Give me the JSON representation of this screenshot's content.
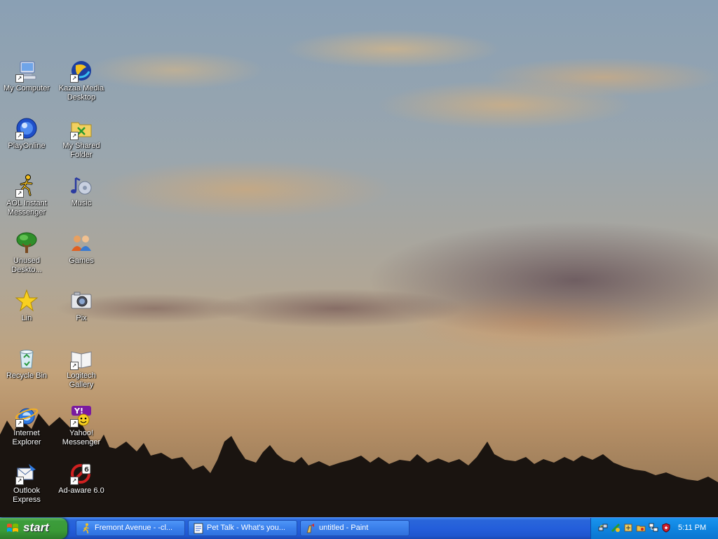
{
  "desktop": {
    "icons": [
      {
        "label": "My Computer",
        "icon": "my-computer-icon",
        "shortcut": true
      },
      {
        "label": "Kazaa Media Desktop",
        "icon": "kazaa-icon",
        "shortcut": true
      },
      {
        "label": "PlayOnline",
        "icon": "playonline-icon",
        "shortcut": true
      },
      {
        "label": "My Shared Folder",
        "icon": "shared-folder-icon",
        "shortcut": true
      },
      {
        "label": "AOL Instant Messenger",
        "icon": "aim-icon",
        "shortcut": true
      },
      {
        "label": "Music",
        "icon": "music-icon",
        "shortcut": false
      },
      {
        "label": "Unused Deskto...",
        "icon": "tree-icon",
        "shortcut": false
      },
      {
        "label": "Games",
        "icon": "games-icon",
        "shortcut": false
      },
      {
        "label": "Lin",
        "icon": "star-icon",
        "shortcut": false
      },
      {
        "label": "Pix",
        "icon": "camera-icon",
        "shortcut": false
      },
      {
        "label": "Recycle Bin",
        "icon": "recycle-bin-icon",
        "shortcut": false
      },
      {
        "label": "Logitech Gallery",
        "icon": "gallery-icon",
        "shortcut": true
      },
      {
        "label": "Internet Explorer",
        "icon": "ie-icon",
        "shortcut": true
      },
      {
        "label": "Yahoo! Messenger",
        "icon": "yahoo-icon",
        "shortcut": true
      },
      {
        "label": "Outlook Express",
        "icon": "outlook-icon",
        "shortcut": true
      },
      {
        "label": "Ad-aware 6.0",
        "icon": "adaware-icon",
        "shortcut": true
      }
    ]
  },
  "taskbar": {
    "start_label": "start",
    "tasks": [
      {
        "label": "Fremont Avenue - -cl...",
        "icon": "aim-runner-icon"
      },
      {
        "label": "Pet Talk - What's you...",
        "icon": "document-icon"
      },
      {
        "label": "untitled - Paint",
        "icon": "paint-icon"
      }
    ],
    "tray_icons": [
      "network-icon",
      "update-icon",
      "security-icon",
      "folder-tray-icon",
      "monitor-tray-icon",
      "shield-tray-icon"
    ],
    "clock": "5:11 PM"
  },
  "colors": {
    "taskbar_blue": "#245edb",
    "start_green": "#3a9a36",
    "tray_blue": "#0f84e0"
  }
}
